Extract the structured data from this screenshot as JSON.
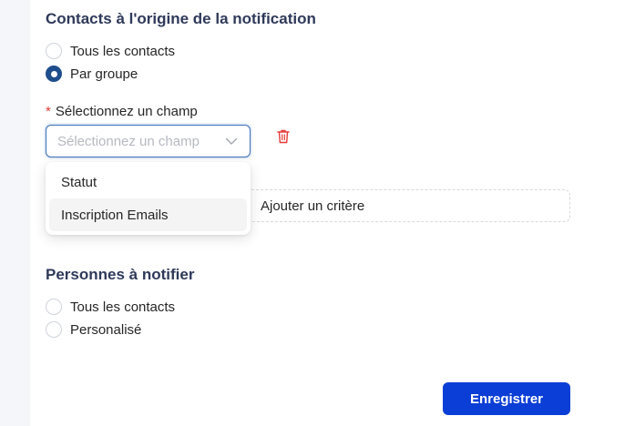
{
  "origin_section": {
    "title": "Contacts à l'origine de la notification",
    "options": [
      {
        "label": "Tous les contacts",
        "checked": false
      },
      {
        "label": "Par groupe",
        "checked": true
      }
    ]
  },
  "field": {
    "required_mark": "*",
    "label": "Sélectionnez un champ",
    "placeholder": "Sélectionnez un champ",
    "dropdown_options": [
      "Statut",
      "Inscription Emails"
    ],
    "highlighted_option": "Inscription Emails"
  },
  "add_criterion_label": "Ajouter un critère",
  "notify_section": {
    "title": "Personnes à notifier",
    "options": [
      {
        "label": "Tous les contacts",
        "checked": false
      },
      {
        "label": "Personalisé",
        "checked": false
      }
    ]
  },
  "save_label": "Enregistrer",
  "colors": {
    "primary_button": "#0b3ed6",
    "radio_checked": "#1f4e8c",
    "heading": "#2f3a5a",
    "required": "#e53935",
    "delete_icon": "#e53935"
  },
  "icons": {
    "select": "chevron-down-icon",
    "delete": "trash-icon"
  }
}
